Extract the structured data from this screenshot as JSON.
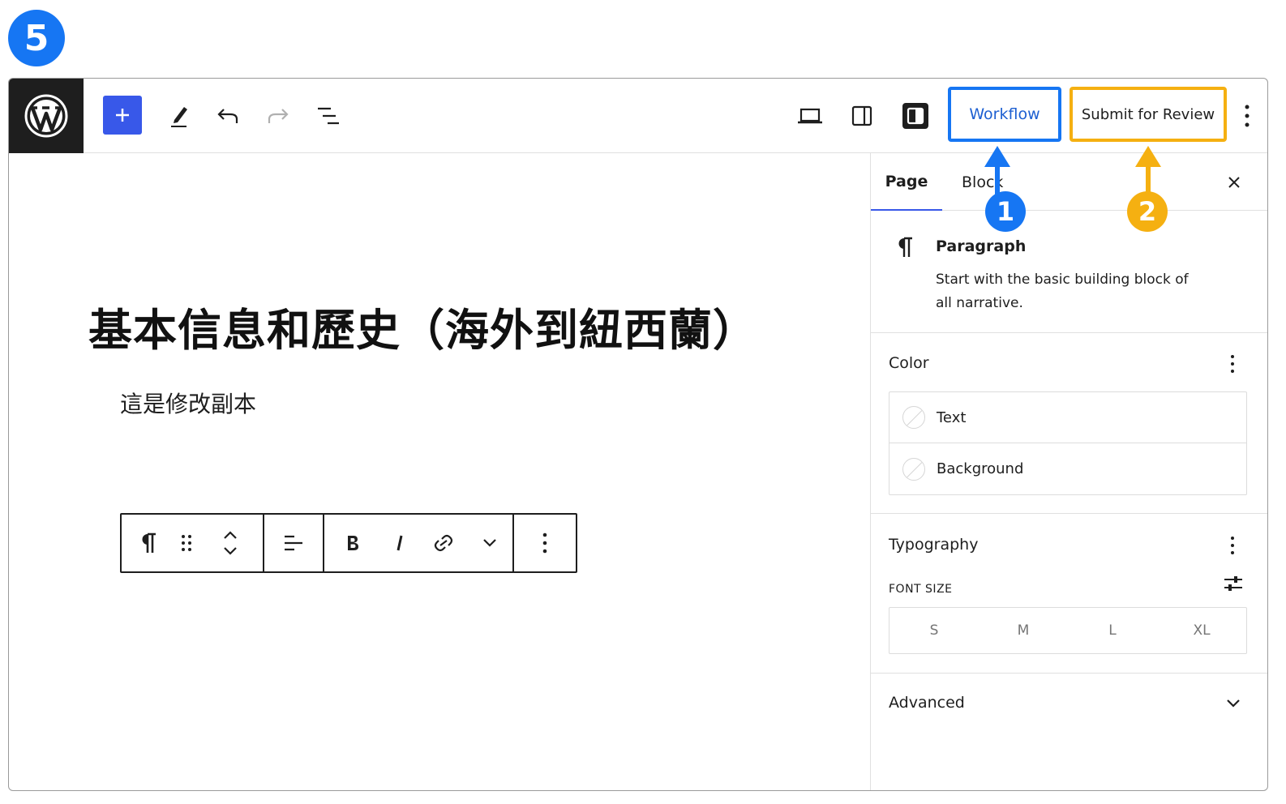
{
  "step_number": "5",
  "toolbar": {
    "workflow_label": "Workflow",
    "submit_label": "Submit for Review",
    "icons": [
      "wordpress-logo",
      "plus-icon",
      "pencil-icon",
      "undo-icon",
      "redo-icon",
      "document-overview-icon",
      "desktop-icon",
      "sidebar-icon",
      "settings-icon",
      "more-vertical-icon"
    ]
  },
  "editor": {
    "title": "基本信息和歷史（海外到紐西蘭）",
    "paragraph": "這是修改副本"
  },
  "sidebar": {
    "tabs": [
      "Page",
      "Block"
    ],
    "block_card": {
      "title": "Paragraph",
      "description": "Start with the basic building block of all narrative."
    },
    "color": {
      "title": "Color",
      "items": [
        "Text",
        "Background"
      ]
    },
    "typography": {
      "title": "Typography",
      "font_size_label": "FONT SIZE",
      "sizes": [
        "S",
        "M",
        "L",
        "XL"
      ]
    },
    "advanced": {
      "title": "Advanced"
    }
  },
  "callouts": {
    "one": "1",
    "two": "2",
    "colors": {
      "one": "#1676f3",
      "two": "#f5b011"
    }
  }
}
